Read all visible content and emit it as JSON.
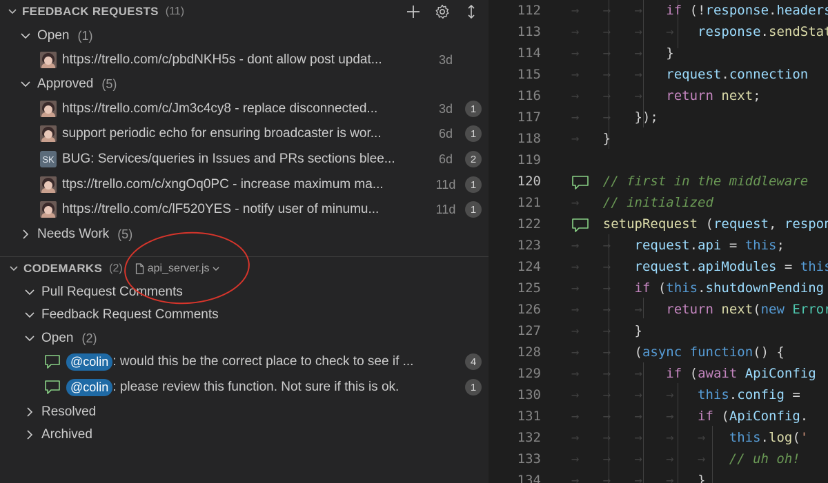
{
  "feedback": {
    "title": "FEEDBACK REQUESTS",
    "count": "(11)",
    "open": {
      "label": "Open",
      "count": "(1)"
    },
    "open_items": [
      {
        "title": "https://trello.com/c/pbdNKH5s - dont allow post updat...",
        "age": "3d"
      }
    ],
    "approved": {
      "label": "Approved",
      "count": "(5)"
    },
    "approved_items": [
      {
        "title": "https://trello.com/c/Jm3c4cy8 - replace disconnected...",
        "age": "3d",
        "badge": "1"
      },
      {
        "title": "support periodic echo for ensuring broadcaster is wor...",
        "age": "6d",
        "badge": "1"
      },
      {
        "title": "BUG: Services/queries in Issues and PRs sections blee...",
        "age": "6d",
        "badge": "2",
        "initials": "SK"
      },
      {
        "title": "ttps://trello.com/c/xngOq0PC - increase maximum ma...",
        "age": "11d",
        "badge": "1"
      },
      {
        "title": "https://trello.com/c/lF520YES - notify user of minumu...",
        "age": "11d",
        "badge": "1"
      }
    ],
    "needs_work": {
      "label": "Needs Work",
      "count": "(5)"
    }
  },
  "codemarks": {
    "title": "CODEMARKS",
    "count": "(2)",
    "file_filter": "api_server.js",
    "pull_request_comments": "Pull Request Comments",
    "feedback_request_comments": "Feedback Request Comments",
    "open": {
      "label": "Open",
      "count": "(2)"
    },
    "items": [
      {
        "mention": "@colin",
        "text": ": would this be the correct place to check to see if ...",
        "badge": "4"
      },
      {
        "mention": "@colin",
        "text": ": please review this function. Not sure if this is ok.",
        "badge": "1"
      }
    ],
    "resolved": "Resolved",
    "archived": "Archived"
  },
  "editor": {
    "line_numbers": [
      "112",
      "113",
      "114",
      "115",
      "116",
      "117",
      "118",
      "119",
      "120",
      "121",
      "122",
      "123",
      "124",
      "125",
      "126",
      "127",
      "128",
      "129",
      "130",
      "131",
      "132",
      "133",
      "134"
    ],
    "active_line": "120"
  },
  "icons": {
    "add": "plus-icon",
    "settings": "gear-icon",
    "sort": "sort-arrows-icon",
    "file": "file-icon",
    "comment": "comment-bubble-icon"
  },
  "colors": {
    "mention": "#1f6aa5",
    "annotation_circle": "#d7352b",
    "comment_bubble": "#89d185"
  }
}
